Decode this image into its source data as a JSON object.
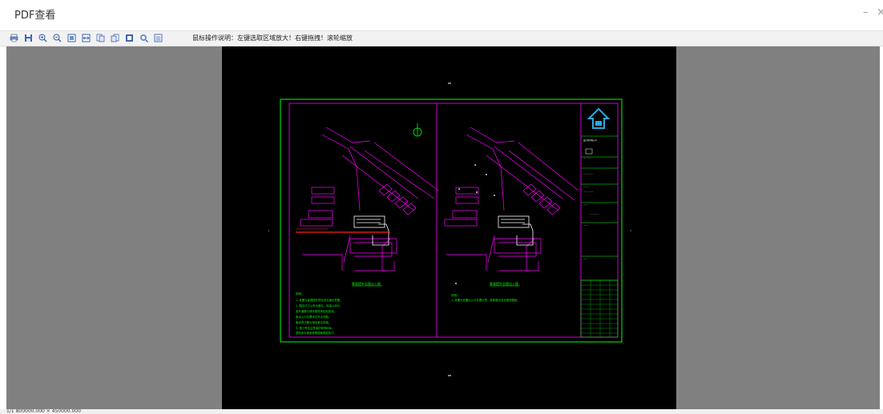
{
  "window": {
    "title": "PDF查看",
    "minimize": "–",
    "close": "×"
  },
  "toolbar": {
    "icons": [
      "print-icon",
      "save-icon",
      "zoom-in-icon",
      "zoom-out-icon",
      "fit-page-icon",
      "fit-width-icon",
      "first-page-icon",
      "last-page-icon",
      "single-page-icon",
      "find-icon",
      "properties-icon"
    ],
    "hint": "鼠标操作说明：左键选取区域放大！右键拖拽！滚轮缩放"
  },
  "drawing": {
    "left_plan_caption": "景观提升总图出入图",
    "right_plan_caption": "景观提升总图出入图",
    "note_heading": "说明:",
    "notes": [
      "1. 本图为景观提升项目总平面示意图。",
      "2. 图中尺寸以米为单位，标高以米计。",
      "   室外道路与绿化按现场实际放线。",
      "   各出入口位置详见节点详图。",
      "   管线改迁需与相关单位协调。",
      "3. 施工时应注意保护现有树木。",
      "   其他未尽事宜参照国家规范执行。"
    ],
    "right_note_heading": "说明:",
    "right_note": "1. 本图为总图出入口位置示意，具体做法详见相关图纸。",
    "logo_text": "设计院有限公司",
    "colors": {
      "frame": "#00ff00",
      "linework": "#ff00ff",
      "road": "#ff2020",
      "text": "#00ff00",
      "building": "#ffffff"
    }
  },
  "status": {
    "text": "1/1    800000.000 × 450000.000"
  }
}
